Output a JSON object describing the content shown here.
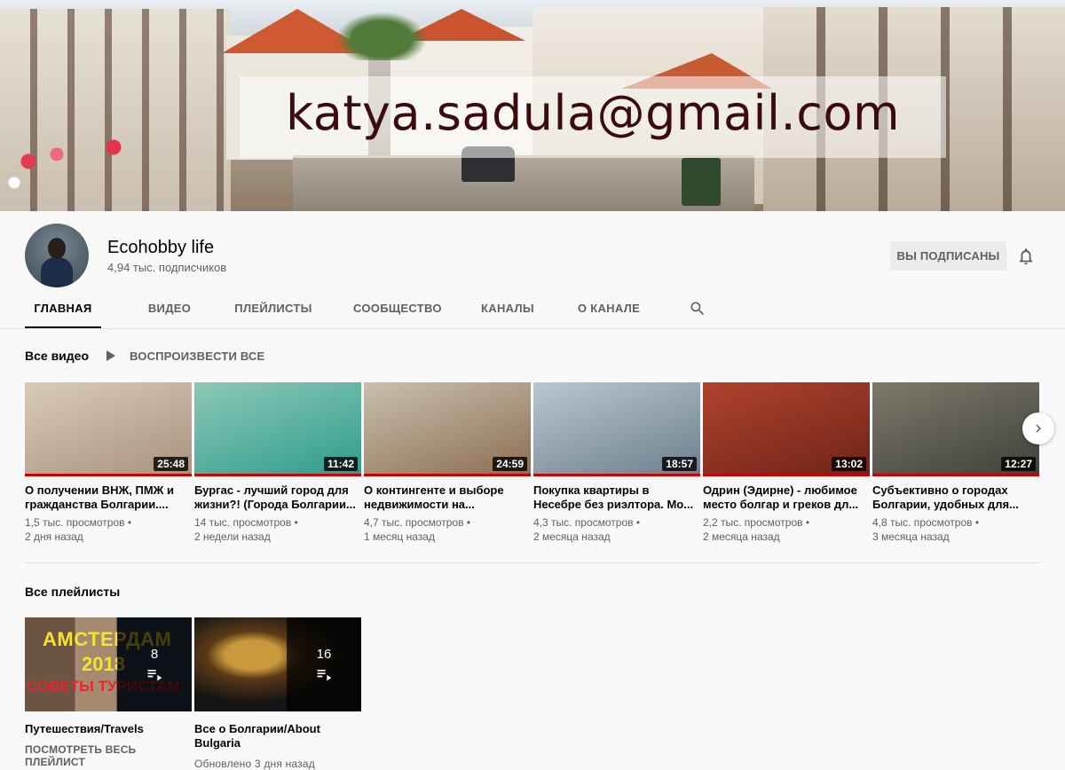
{
  "banner": {
    "email": "katya.sadula@gmail.com"
  },
  "channel": {
    "name": "Ecohobby life",
    "subscribers": "4,94 тыс. подписчиков",
    "subscribe_label": "ВЫ ПОДПИСАНЫ"
  },
  "tabs": [
    {
      "label": "ГЛАВНАЯ",
      "active": true
    },
    {
      "label": "ВИДЕО"
    },
    {
      "label": "ПЛЕЙЛИСТЫ"
    },
    {
      "label": "СООБЩЕСТВО"
    },
    {
      "label": "КАНАЛЫ"
    },
    {
      "label": "О КАНАЛЕ"
    }
  ],
  "videos_shelf": {
    "title": "Все видео",
    "play_all": "ВОСПРОИЗВЕСТИ ВСЕ",
    "videos": [
      {
        "title": "О получении ВНЖ, ПМЖ и гражданства Болгарии....",
        "duration": "25:48",
        "views": "1,5 тыс. просмотров •",
        "age": "2 дня назад",
        "colors": [
          "#d9cbb8",
          "#a8927c"
        ]
      },
      {
        "title": "Бургас - лучший город для жизни?! (Города Болгарии...",
        "duration": "11:42",
        "views": "14 тыс. просмотров •",
        "age": "2 недели назад",
        "colors": [
          "#8ec8b6",
          "#2d9c8c"
        ]
      },
      {
        "title": "О контингенте и выборе недвижимости на...",
        "duration": "24:59",
        "views": "4,7 тыс. просмотров •",
        "age": "1 месяц назад",
        "colors": [
          "#c9c0ad",
          "#8c6d52"
        ]
      },
      {
        "title": "Покупка квартиры в Несебре без риэлтора. Мо...",
        "duration": "18:57",
        "views": "4,3 тыс. просмотров •",
        "age": "2 месяца назад",
        "colors": [
          "#b8c7d2",
          "#6c7f8c"
        ]
      },
      {
        "title": "Одрин (Эдирне) - любимое место болгар и греков дл...",
        "duration": "13:02",
        "views": "2,2 тыс. просмотров •",
        "age": "2 месяца назад",
        "colors": [
          "#b0432e",
          "#6e2318"
        ]
      },
      {
        "title": "Субъективно о городах Болгарии, удобных для...",
        "duration": "12:27",
        "views": "4,8 тыс. просмотров •",
        "age": "3 месяца назад",
        "colors": [
          "#7d7a6b",
          "#40403a"
        ]
      }
    ]
  },
  "playlists_shelf": {
    "title": "Все плейлисты",
    "playlists": [
      {
        "title": "Путешествия/Travels",
        "count": "8",
        "sub": "ПОСМОТРЕТЬ ВЕСЬ ПЛЕЙЛИСТ",
        "thumb_text_1": "АМСТЕРДАМ",
        "thumb_text_2": "2018",
        "thumb_text_3": "СОВЕТЫ ТУРИСТАМ"
      },
      {
        "title": "Все о Болгарии/About Bulgaria",
        "count": "16",
        "sub": "Обновлено 3 дня назад"
      }
    ]
  }
}
